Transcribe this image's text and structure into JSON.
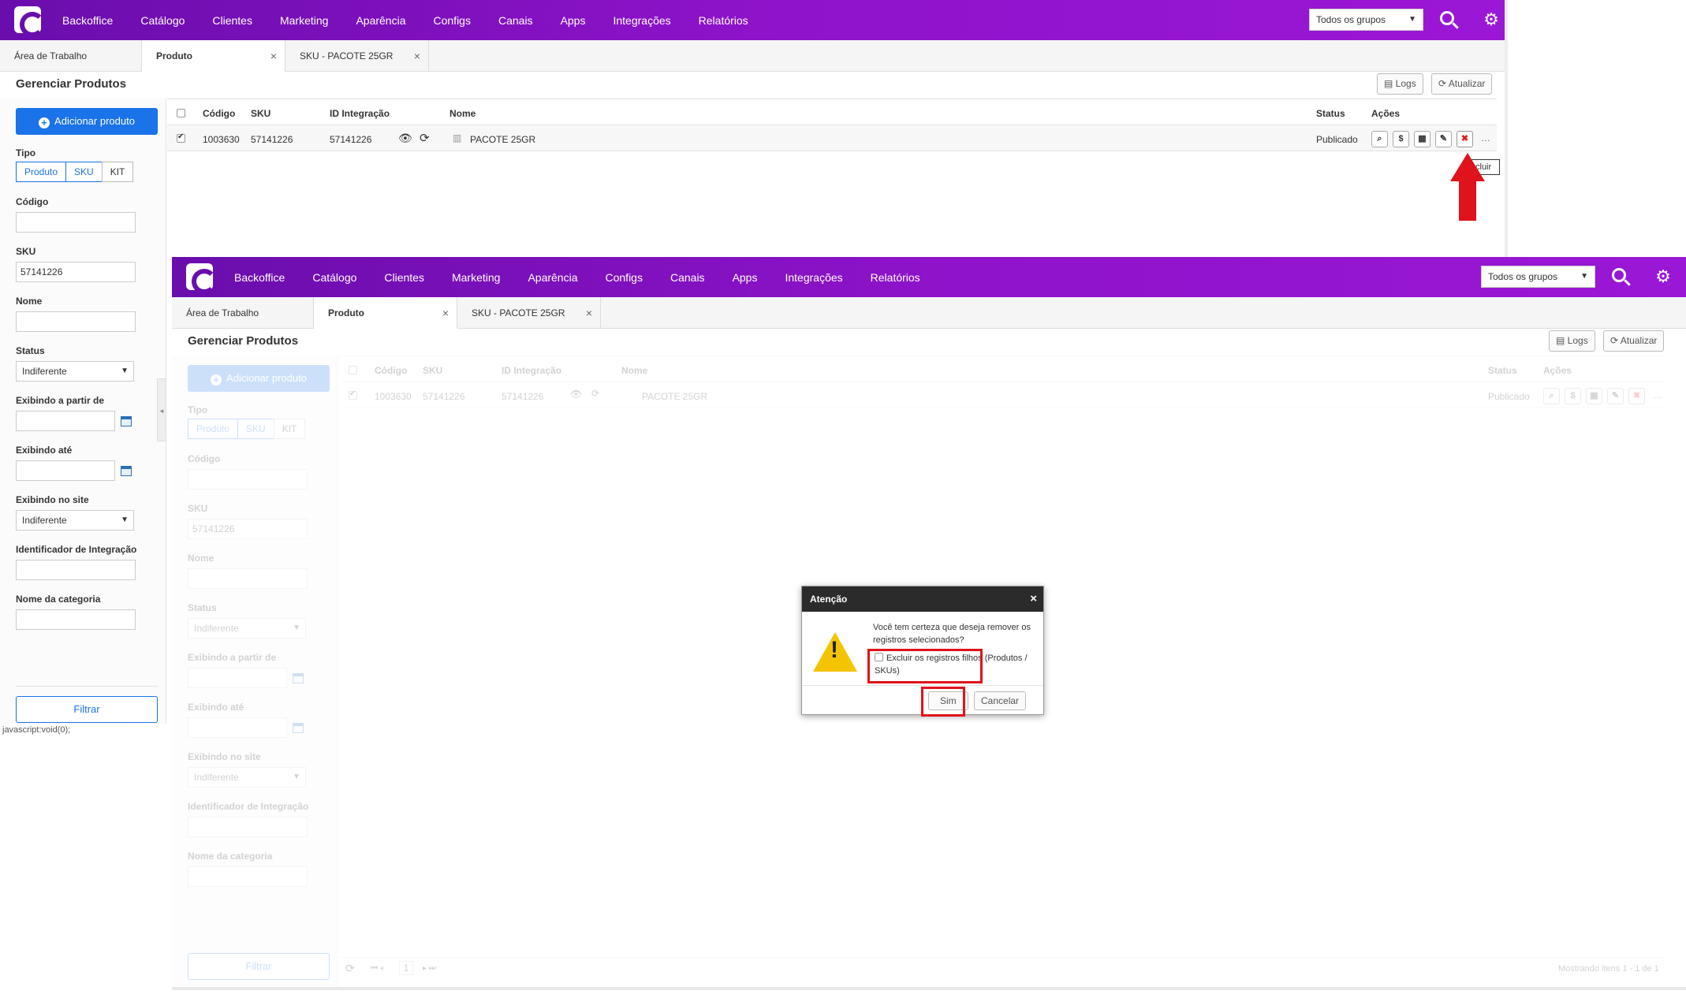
{
  "nav": {
    "items": [
      "Backoffice",
      "Catálogo",
      "Clientes",
      "Marketing",
      "Aparência",
      "Configs",
      "Canais",
      "Apps",
      "Integrações",
      "Relatórios"
    ],
    "group_select": "Todos os grupos"
  },
  "tabs": {
    "workspace": "Área de Trabalho",
    "product": "Produto",
    "sku": "SKU - PACOTE 25GR",
    "close": "×"
  },
  "page": {
    "title": "Gerenciar Produtos",
    "logs": "Logs",
    "refresh": "Atualizar"
  },
  "sidebar": {
    "add_product": "Adicionar produto",
    "type_label": "Tipo",
    "type_options": [
      "Produto",
      "SKU",
      "KIT"
    ],
    "code_label": "Código",
    "code_value": "",
    "sku_label": "SKU",
    "sku_value": "57141226",
    "name_label": "Nome",
    "status_label": "Status",
    "status_value": "Indiferente",
    "from_label": "Exibindo a partir de",
    "until_label": "Exibindo até",
    "site_label": "Exibindo no site",
    "site_value": "Indiferente",
    "integration_label": "Identificador de Integração",
    "category_label": "Nome da categoria",
    "filter_button": "Filtrar"
  },
  "grid": {
    "headers": {
      "code": "Código",
      "sku": "SKU",
      "integration": "ID Integração",
      "name": "Nome",
      "status": "Status",
      "actions": "Ações"
    },
    "rows": [
      {
        "code": "1003630",
        "sku": "57141226",
        "integration": "57141226",
        "name": "PACOTE 25GR",
        "status": "Publicado"
      }
    ],
    "tooltip": "cluir",
    "footer": "Mostrando itens 1 - 1 de 1",
    "page": "1"
  },
  "status_bar": "javascript:void(0);",
  "dialog": {
    "title": "Atenção",
    "close": "×",
    "message": "Você tem certeza que deseja remover os registros selecionados?",
    "checkbox_label": "Excluir os registros filhos (Produtos / SKUs)",
    "confirm": "Sim",
    "cancel": "Cancelar"
  },
  "colors": {
    "nav_gradient_start": "#6a0dad",
    "nav_gradient_end": "#9a17d6",
    "primary": "#1a73e8",
    "highlight": "#e0121b",
    "warning": "#f5c400"
  }
}
